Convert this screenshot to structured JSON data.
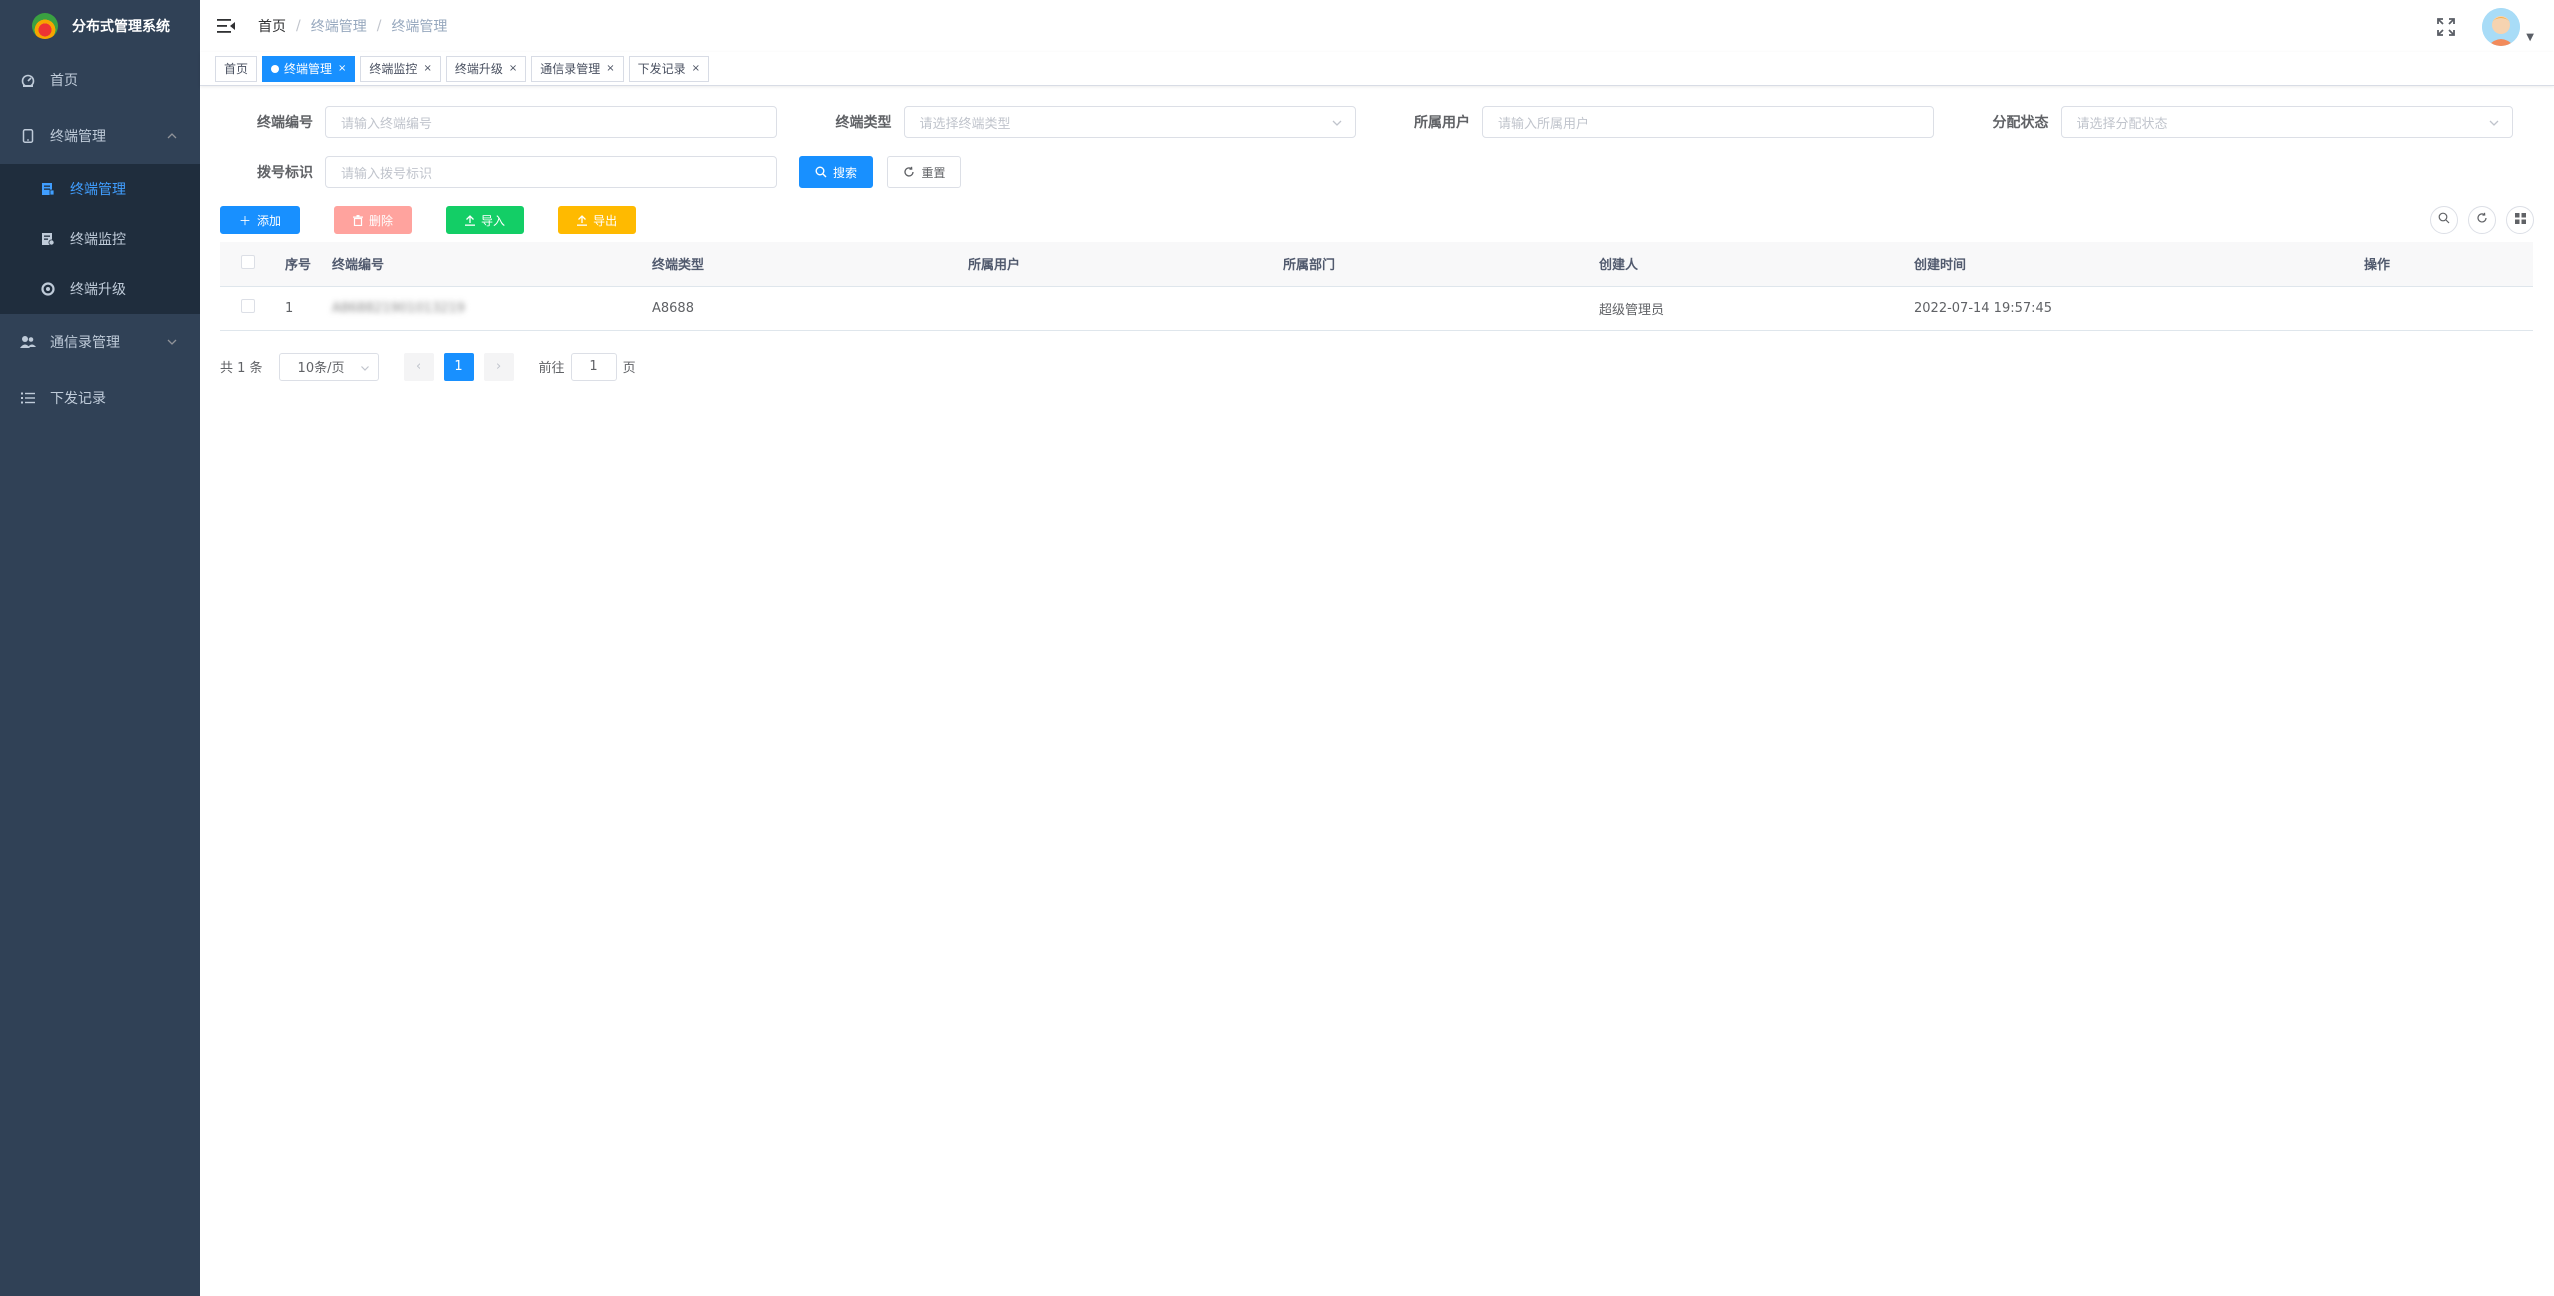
{
  "app": {
    "title": "分布式管理系统"
  },
  "sidebar": {
    "items": [
      {
        "label": "首页",
        "icon": "dashboard-icon"
      },
      {
        "label": "终端管理",
        "icon": "phone-icon",
        "expanded": true,
        "children": [
          {
            "label": "终端管理",
            "icon": "form-icon",
            "active": true
          },
          {
            "label": "终端监控",
            "icon": "monitor-icon"
          },
          {
            "label": "终端升级",
            "icon": "upgrade-icon"
          }
        ]
      },
      {
        "label": "通信录管理",
        "icon": "people-icon"
      },
      {
        "label": "下发记录",
        "icon": "list-icon"
      }
    ]
  },
  "breadcrumb": [
    "首页",
    "终端管理",
    "终端管理"
  ],
  "tags": [
    {
      "label": "首页",
      "active": false,
      "closable": false
    },
    {
      "label": "终端管理",
      "active": true,
      "closable": true
    },
    {
      "label": "终端监控",
      "active": false,
      "closable": true
    },
    {
      "label": "终端升级",
      "active": false,
      "closable": true
    },
    {
      "label": "通信录管理",
      "active": false,
      "closable": true
    },
    {
      "label": "下发记录",
      "active": false,
      "closable": true
    }
  ],
  "search": {
    "terminal_no": {
      "label": "终端编号",
      "placeholder": "请输入终端编号"
    },
    "terminal_type": {
      "label": "终端类型",
      "placeholder": "请选择终端类型"
    },
    "owner_user": {
      "label": "所属用户",
      "placeholder": "请输入所属用户"
    },
    "assign_status": {
      "label": "分配状态",
      "placeholder": "请选择分配状态"
    },
    "dial_id": {
      "label": "拨号标识",
      "placeholder": "请输入拨号标识"
    },
    "search_btn": "搜索",
    "reset_btn": "重置"
  },
  "toolbar": {
    "add": "添加",
    "delete": "删除",
    "import": "导入",
    "export": "导出"
  },
  "table": {
    "headers": [
      "序号",
      "终端编号",
      "终端类型",
      "所属用户",
      "所属部门",
      "创建人",
      "创建时间",
      "操作"
    ],
    "rows": [
      {
        "index": "1",
        "terminal_no": "A868821901013219",
        "type": "A8688",
        "user": "",
        "dept": "",
        "creator": "超级管理员",
        "created": "2022-07-14 19:57:45",
        "ops": ""
      }
    ]
  },
  "pagination": {
    "total_text": "共 1 条",
    "page_size": "10条/页",
    "current": "1",
    "goto_label": "前往",
    "goto_value": "1",
    "page_suffix": "页"
  },
  "colors": {
    "sidebar_bg": "#304156",
    "submenu_bg": "#1f2d3d",
    "primary": "#1890ff",
    "danger": "#ffa39e",
    "success": "#13ce66",
    "warning": "#ffba00"
  }
}
